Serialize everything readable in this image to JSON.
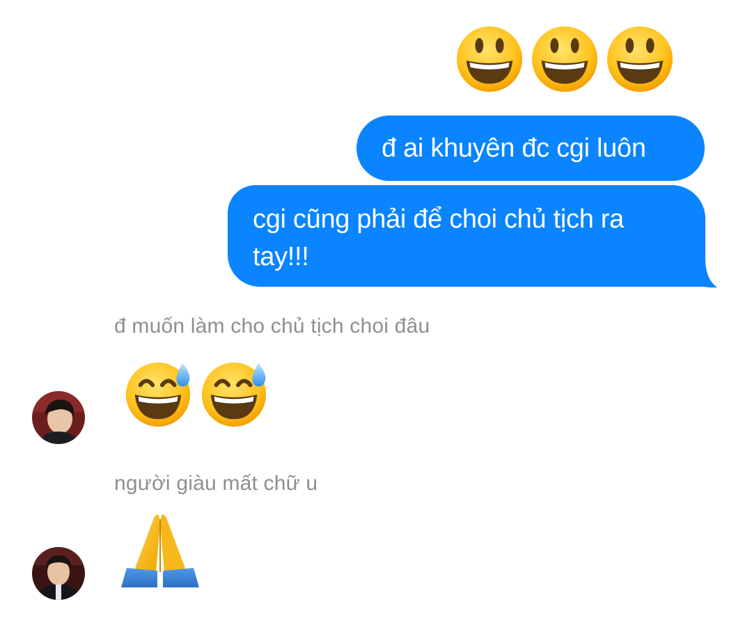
{
  "conversation": {
    "outgoing": {
      "emoji_row": [
        "grinning-face",
        "grinning-face",
        "grinning-face"
      ],
      "messages": [
        {
          "text": "đ ai khuyên đc cgi luôn"
        },
        {
          "text": "cgi cũng phải để choi chủ tịch ra tay!!!"
        }
      ]
    },
    "incoming": [
      {
        "reply_note": "đ muốn làm cho chủ tịch choi đâu",
        "emoji": [
          "grinning-face-with-sweat",
          "grinning-face-with-sweat"
        ]
      },
      {
        "reply_note": "người giàu mất chữ u",
        "emoji": [
          "folded-hands"
        ]
      }
    ]
  },
  "colors": {
    "outgoing_bubble": "#0A84FF",
    "outgoing_text": "#ffffff",
    "note_text": "#8e8e93",
    "background": "#ffffff"
  }
}
